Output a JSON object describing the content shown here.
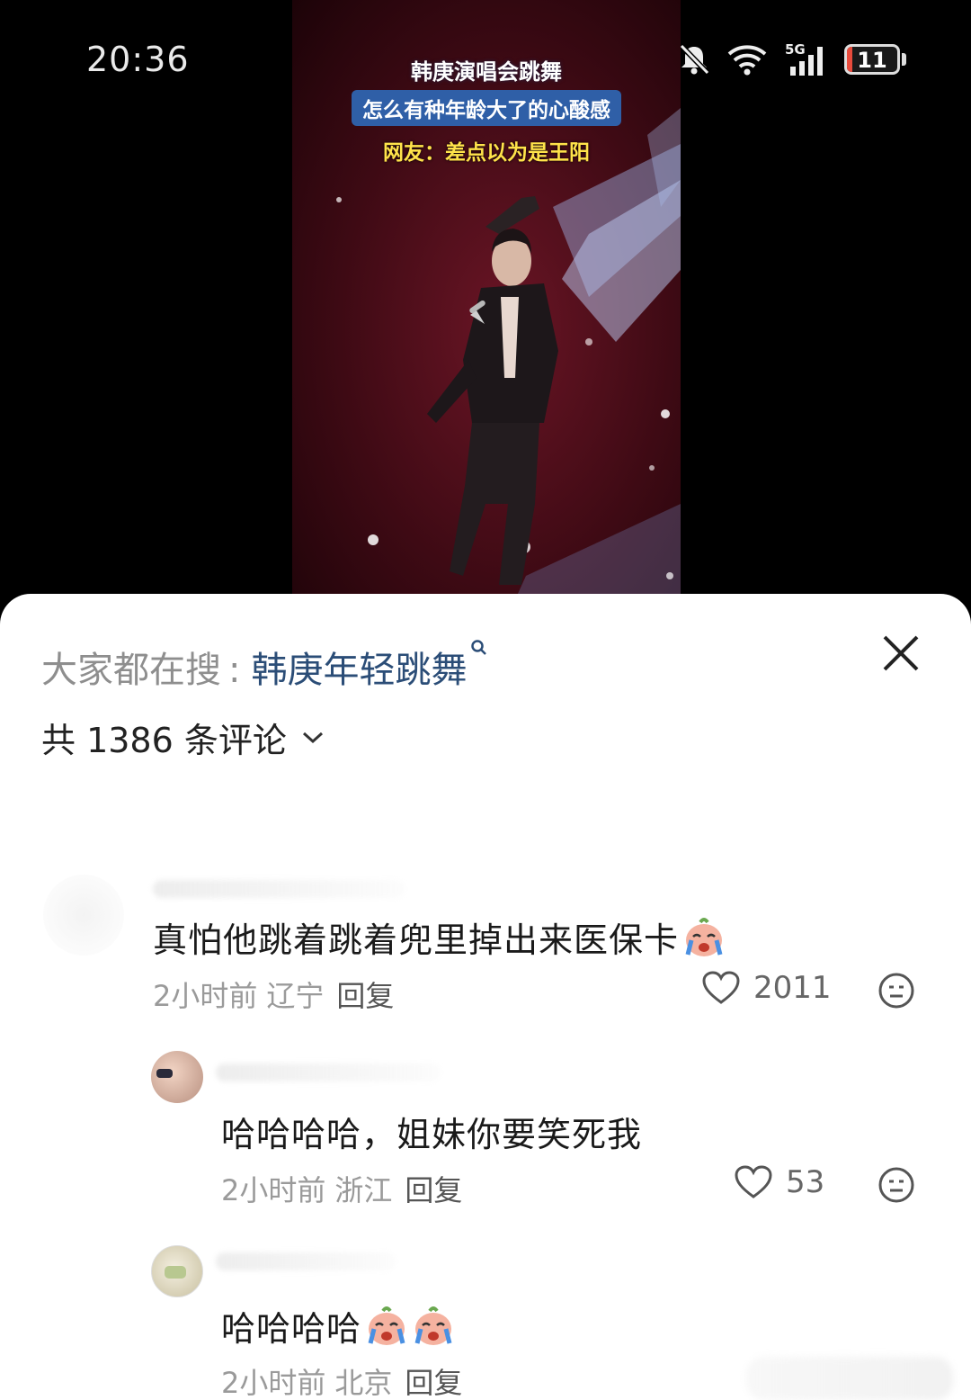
{
  "status_bar": {
    "time": "20:36",
    "network": "5G",
    "battery": "11",
    "battery_level": 0.11,
    "icons": [
      "mute-bell-icon",
      "wifi-icon",
      "signal-icon",
      "battery-icon"
    ]
  },
  "video": {
    "caption_line1": "韩庚演唱会跳舞",
    "caption_line2": "怎么有种年龄大了的心酸感",
    "caption_line3": "网友：差点以为是王阳"
  },
  "sheet": {
    "search_prefix": "大家都在搜",
    "search_sep": ":",
    "search_term": "韩庚年轻跳舞",
    "comment_count_label": "共 1386 条评论",
    "close_icon": "close-icon",
    "colors": {
      "search_term": "#2b4d77",
      "meta": "#9a9a9a",
      "text": "#1a1a1a"
    }
  },
  "comments": [
    {
      "text": "真怕他跳着跳着兜里掉出来医保卡",
      "emoji_count": 1,
      "time": "2小时前",
      "location": "辽宁",
      "reply": "回复",
      "likes": "2011"
    },
    {
      "text": "哈哈哈哈，姐妹你要笑死我",
      "emoji_count": 0,
      "time": "2小时前",
      "location": "浙江",
      "reply": "回复",
      "likes": "53"
    },
    {
      "text": "哈哈哈哈",
      "emoji_count": 2,
      "time": "2小时前",
      "location": "北京",
      "reply": "回复",
      "likes": ""
    }
  ]
}
